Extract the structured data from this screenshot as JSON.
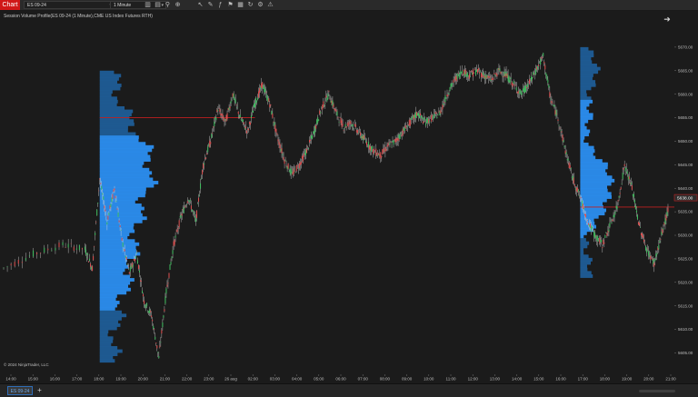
{
  "toolbar": {
    "chart_label": "Chart",
    "instrument": "ES 09-24",
    "interval": "1 Minute",
    "icons": [
      "bar-chart-icon",
      "bar-chart-style-icon",
      "magnify-icon",
      "zoom-icon",
      "pointer-icon",
      "draw-tools-icon",
      "indicators-icon",
      "strategies-icon",
      "templates-icon",
      "rollover-icon",
      "properties-icon",
      "alert-icon"
    ]
  },
  "chart": {
    "title": "Session Volume Profile(ES 09-24 (1 Minute),CME US Index Futures RTH)",
    "copyright": "© 2024 NinjaTrader, LLC",
    "current_price": "5638.00",
    "colors": {
      "background": "#1b1b1b",
      "up_candle": "#3fbf5f",
      "down_candle": "#e04f4f",
      "profile_bright": "#2b8ef0",
      "profile_dark": "#1f5d97",
      "poc_line": "#c02020",
      "price_marker": "#c02020"
    }
  },
  "chart_data": {
    "type": "candlestick",
    "title": "",
    "y_ticks": [
      "5670.00",
      "5665.00",
      "5660.00",
      "5655.00",
      "5650.00",
      "5645.00",
      "5640.00",
      "5635.00",
      "5630.00",
      "5625.00",
      "5620.00",
      "5615.00",
      "5610.00",
      "5605.00"
    ],
    "x_ticks": [
      "14:00",
      "15:00",
      "16:00",
      "17:00",
      "18:00",
      "19:00",
      "20:00",
      "21:00",
      "22:00",
      "23:00",
      "26 aug",
      "02:00",
      "03:00",
      "04:00",
      "05:00",
      "06:00",
      "07:00",
      "08:00",
      "09:00",
      "10:00",
      "11:00",
      "12:00",
      "13:00",
      "14:00",
      "15:00",
      "16:00",
      "17:00",
      "18:00",
      "19:00",
      "20:00",
      "21:00"
    ],
    "ylim": [
      5602,
      5675
    ],
    "price_path": [
      [
        0,
        5623
      ],
      [
        4,
        5626
      ],
      [
        8,
        5628
      ],
      [
        11,
        5627
      ],
      [
        12,
        5623
      ],
      [
        13,
        5642
      ],
      [
        14,
        5633
      ],
      [
        15,
        5640
      ],
      [
        16,
        5629
      ],
      [
        17,
        5622
      ],
      [
        18,
        5626
      ],
      [
        19,
        5616
      ],
      [
        20,
        5613
      ],
      [
        21,
        5604
      ],
      [
        22,
        5618
      ],
      [
        23,
        5628
      ],
      [
        24,
        5634
      ],
      [
        25,
        5638
      ],
      [
        26,
        5633
      ],
      [
        27,
        5645
      ],
      [
        28,
        5650
      ],
      [
        29,
        5657
      ],
      [
        30,
        5654
      ],
      [
        31,
        5660
      ],
      [
        32,
        5655
      ],
      [
        33,
        5652
      ],
      [
        34,
        5658
      ],
      [
        35,
        5662
      ],
      [
        36,
        5658
      ],
      [
        37,
        5651
      ],
      [
        38,
        5646
      ],
      [
        39,
        5643
      ],
      [
        40,
        5645
      ],
      [
        41,
        5648
      ],
      [
        42,
        5652
      ],
      [
        43,
        5657
      ],
      [
        44,
        5660
      ],
      [
        45,
        5656
      ],
      [
        46,
        5653
      ],
      [
        47,
        5654
      ],
      [
        48,
        5652
      ],
      [
        49,
        5650
      ],
      [
        50,
        5648
      ],
      [
        51,
        5647
      ],
      [
        52,
        5649
      ],
      [
        53,
        5650
      ],
      [
        54,
        5652
      ],
      [
        55,
        5654
      ],
      [
        56,
        5656
      ],
      [
        57,
        5654
      ],
      [
        58,
        5655
      ],
      [
        59,
        5656
      ],
      [
        60,
        5660
      ],
      [
        61,
        5663
      ],
      [
        62,
        5665
      ],
      [
        63,
        5664
      ],
      [
        64,
        5665
      ],
      [
        65,
        5664
      ],
      [
        66,
        5663
      ],
      [
        67,
        5665
      ],
      [
        68,
        5664
      ],
      [
        69,
        5662
      ],
      [
        70,
        5660
      ],
      [
        71,
        5662
      ],
      [
        72,
        5665
      ],
      [
        73,
        5668
      ],
      [
        74,
        5659
      ],
      [
        75,
        5655
      ],
      [
        76,
        5648
      ],
      [
        77,
        5642
      ],
      [
        78,
        5638
      ],
      [
        79,
        5633
      ],
      [
        80,
        5630
      ],
      [
        81,
        5628
      ],
      [
        82,
        5632
      ],
      [
        83,
        5636
      ],
      [
        84,
        5645
      ],
      [
        85,
        5640
      ],
      [
        86,
        5632
      ],
      [
        87,
        5627
      ],
      [
        88,
        5624
      ],
      [
        89,
        5630
      ],
      [
        90,
        5636
      ]
    ],
    "x_domain": [
      0,
      90
    ],
    "poc_levels": [
      {
        "session": 1,
        "price": 5655
      },
      {
        "session": 2,
        "price": 5636
      }
    ],
    "volume_profiles": [
      {
        "session": 1,
        "x_start": 13,
        "y_range": [
          5603,
          5665
        ]
      },
      {
        "session": 2,
        "x_start": 78,
        "y_range": [
          5621,
          5670
        ]
      }
    ]
  },
  "bottom": {
    "tab_label": "ES 09-24",
    "add_label": "+"
  }
}
